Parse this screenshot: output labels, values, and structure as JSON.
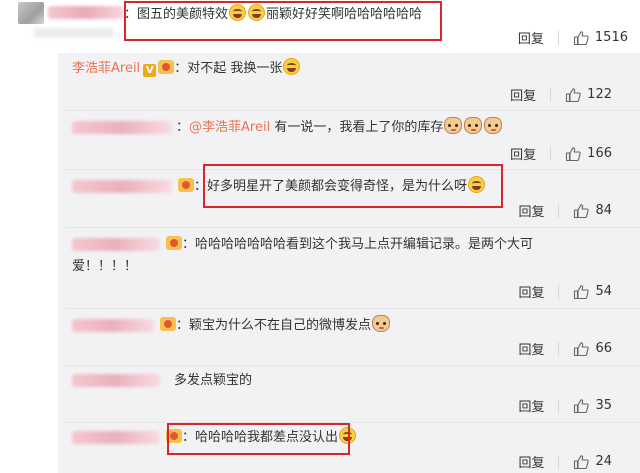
{
  "top_comment": {
    "prefix": "：",
    "text_a": "图五的美颜特效",
    "text_b": "丽颖好好笑啊哈哈哈哈哈哈",
    "reply_label": "回复",
    "likes": "1516"
  },
  "replies": [
    {
      "author": "李浩菲Areil",
      "sep": "：",
      "text": "对不起 我换一张",
      "reply_label": "回复",
      "likes": "122"
    },
    {
      "sep": "：",
      "mention": "@李浩菲Areil",
      "text": " 有一说一，我看上了你的库存",
      "reply_label": "回复",
      "likes": "166"
    },
    {
      "sep": "：",
      "text": "好多明星开了美颜都会变得奇怪，是为什么呀",
      "reply_label": "回复",
      "likes": "84"
    },
    {
      "sep": "：",
      "text": "哈哈哈哈哈哈哈看到这个我马上点开编辑记录。是两个大可",
      "text_line2": "爱！！！！",
      "reply_label": "回复",
      "likes": "54"
    },
    {
      "sep": "：",
      "text": "颖宝为什么不在自己的微博发点",
      "reply_label": "回复",
      "likes": "66"
    },
    {
      "text": "多发点颖宝的",
      "reply_label": "回复",
      "likes": "35"
    },
    {
      "sep": "：",
      "text": "哈哈哈哈我都差点没认出",
      "reply_label": "回复",
      "likes": "24"
    }
  ],
  "icons": {
    "like": "thumbs-up-icon",
    "laugh": "laughing-emoji-icon",
    "cat": "cat-emoji-icon"
  },
  "colors": {
    "link": "#eb7350",
    "highlight_box": "#d9262b",
    "thread_bg": "#f2f2f5"
  }
}
